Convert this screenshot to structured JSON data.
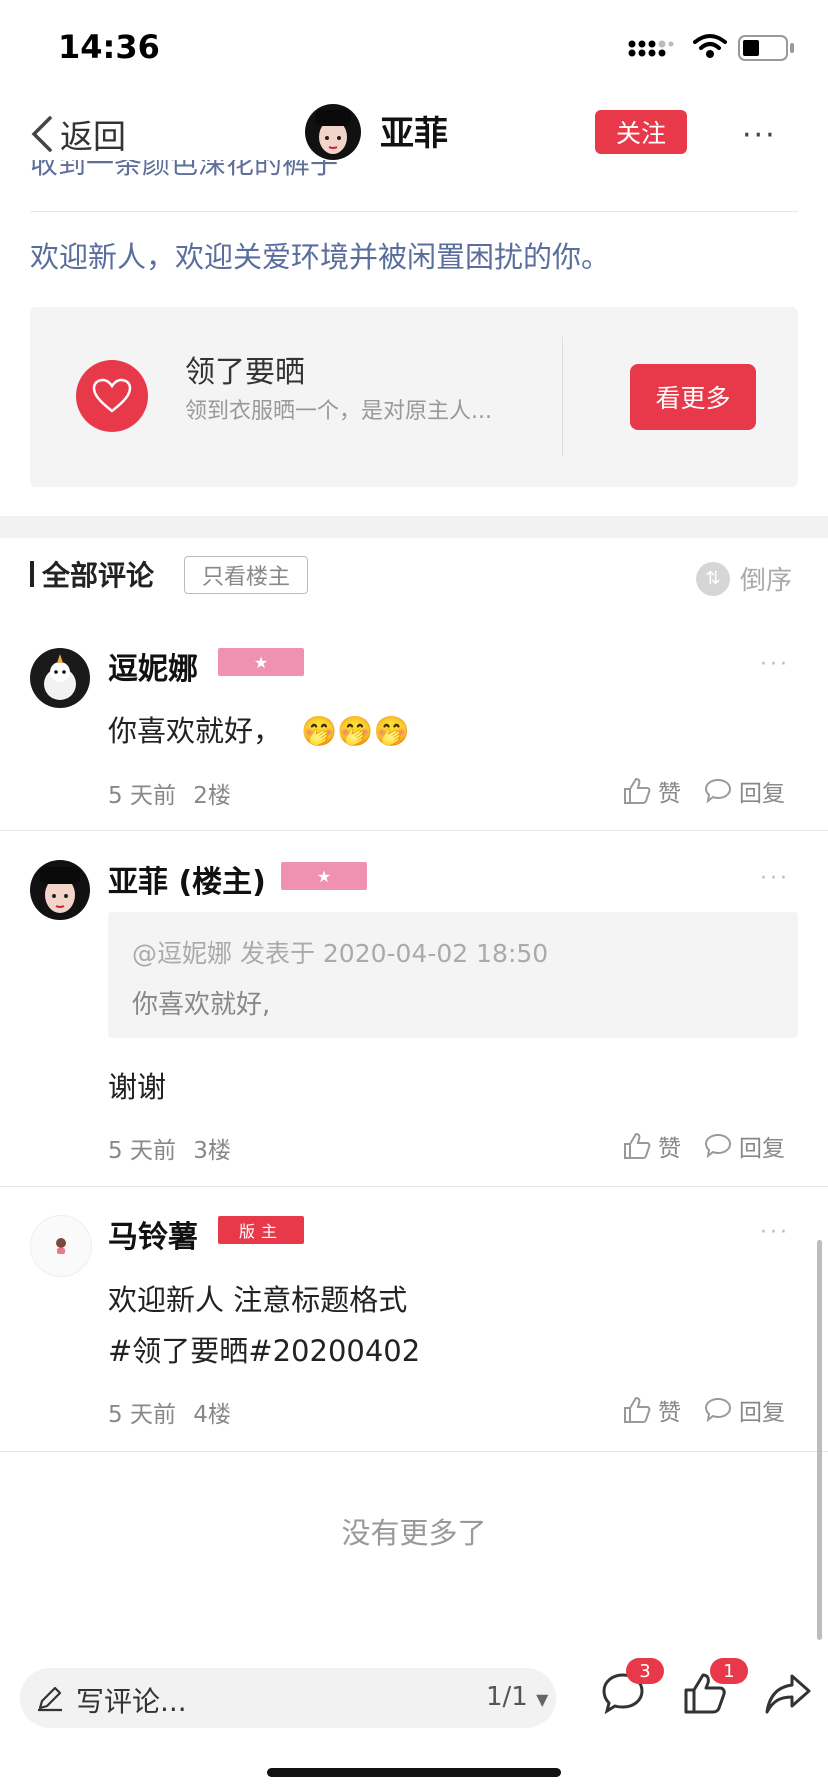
{
  "status_bar": {
    "time": "14:36"
  },
  "nav": {
    "back_label": "返回",
    "author_name": "亚菲",
    "follow_label": "关注",
    "more_label": "···"
  },
  "post": {
    "cut_text": "收到一条颜色深花的裤子",
    "welcome_text": "欢迎新人，欢迎关爱环境并被闲置困扰的你。",
    "card": {
      "title": "领了要晒",
      "subtitle": "领到衣服晒一个，是对原主人...",
      "button_label": "看更多"
    }
  },
  "comments_section": {
    "title": "全部评论",
    "only_host_label": "只看楼主",
    "sort_label": "倒序",
    "comments": [
      {
        "name": "逗妮娜",
        "badge": "★",
        "text": "你喜欢就好，",
        "emojis": "🤭🤭🤭",
        "time": "5 天前",
        "floor": "2楼",
        "like_label": "赞",
        "reply_label": "回复"
      },
      {
        "name": "亚菲 (楼主)",
        "badge": "★",
        "quote_header": "@逗妮娜 发表于 2020-04-02 18:50",
        "quote_text": "你喜欢就好,",
        "text": "谢谢",
        "time": "5 天前",
        "floor": "3楼",
        "like_label": "赞",
        "reply_label": "回复"
      },
      {
        "name": "马铃薯",
        "badge": "版主",
        "text_line1": "欢迎新人 注意标题格式",
        "text_line2": "#领了要晒#20200402",
        "time": "5 天前",
        "floor": "4楼",
        "like_label": "赞",
        "reply_label": "回复"
      }
    ],
    "no_more": "没有更多了"
  },
  "bottom_bar": {
    "input_placeholder": "写评论...",
    "page_indicator": "1/1",
    "comment_count": "3",
    "like_count": "1"
  },
  "colors": {
    "accent_red": "#e8394a",
    "badge_pink": "#ef92b1",
    "link_blue": "#5a6e9d"
  },
  "icons": [
    "back-chevron-icon",
    "more-icon",
    "heart-icon",
    "sort-icon",
    "thumbs-up-icon",
    "reply-bubble-icon",
    "pen-icon",
    "comment-icon",
    "share-icon",
    "signal-icon",
    "wifi-icon",
    "battery-icon"
  ]
}
